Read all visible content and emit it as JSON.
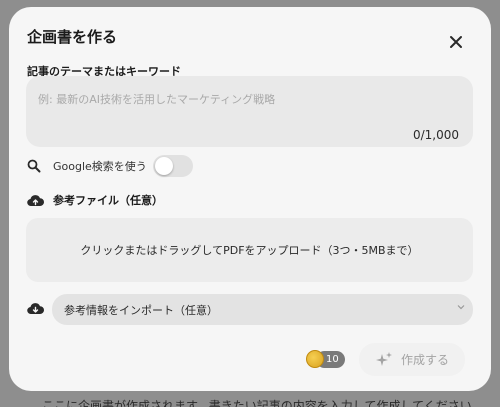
{
  "backdrop": {
    "text": "ここに企画書が作成されます。書きたい記事の内容を入力して作成してください"
  },
  "modal": {
    "title": "企画書を作る",
    "close_icon": "close-icon",
    "topic": {
      "label": "記事のテーマまたはキーワード",
      "placeholder": "例: 最新のAI技術を活用したマーケティング戦略",
      "value": "",
      "counter": "0/1,000"
    },
    "google_search": {
      "icon": "search-icon",
      "label": "Google検索を使う",
      "enabled": false
    },
    "reference_file": {
      "icon": "cloud-upload-icon",
      "label": "参考ファイル（任意）",
      "upload_text": "クリックまたはドラッグしてPDFをアップロード（3つ・5MBまで）"
    },
    "import": {
      "icon": "cloud-download-icon",
      "selected": "参考情報をインポート（任意）"
    },
    "credits": {
      "icon": "coin-icon",
      "value": "10"
    },
    "create_button": {
      "icon": "sparkle-icon",
      "label": "作成する"
    }
  },
  "colors": {
    "overlay": "#8e8e8e",
    "modal_bg": "#f6f6f6",
    "input_bg": "#e9e9e9",
    "toggle_off": "#e1e1e1",
    "coin": "#e0ab2a",
    "disabled_text": "#a3a3a3"
  }
}
